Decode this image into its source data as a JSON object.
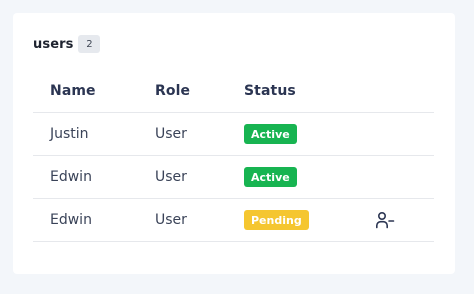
{
  "card": {
    "title": "users",
    "count": "2"
  },
  "table": {
    "columns": [
      "Name",
      "Role",
      "Status"
    ],
    "rows": [
      {
        "name": "Justin",
        "role": "User",
        "status": "Active"
      },
      {
        "name": "Edwin",
        "role": "User",
        "status": "Active"
      },
      {
        "name": "Edwin",
        "role": "User",
        "status": "Pending",
        "action_icon": "remove-user-icon"
      }
    ]
  },
  "colors": {
    "active": "#17b451",
    "pending": "#f5c630",
    "header_text": "#2b3552",
    "background": "#f3f6fa"
  }
}
